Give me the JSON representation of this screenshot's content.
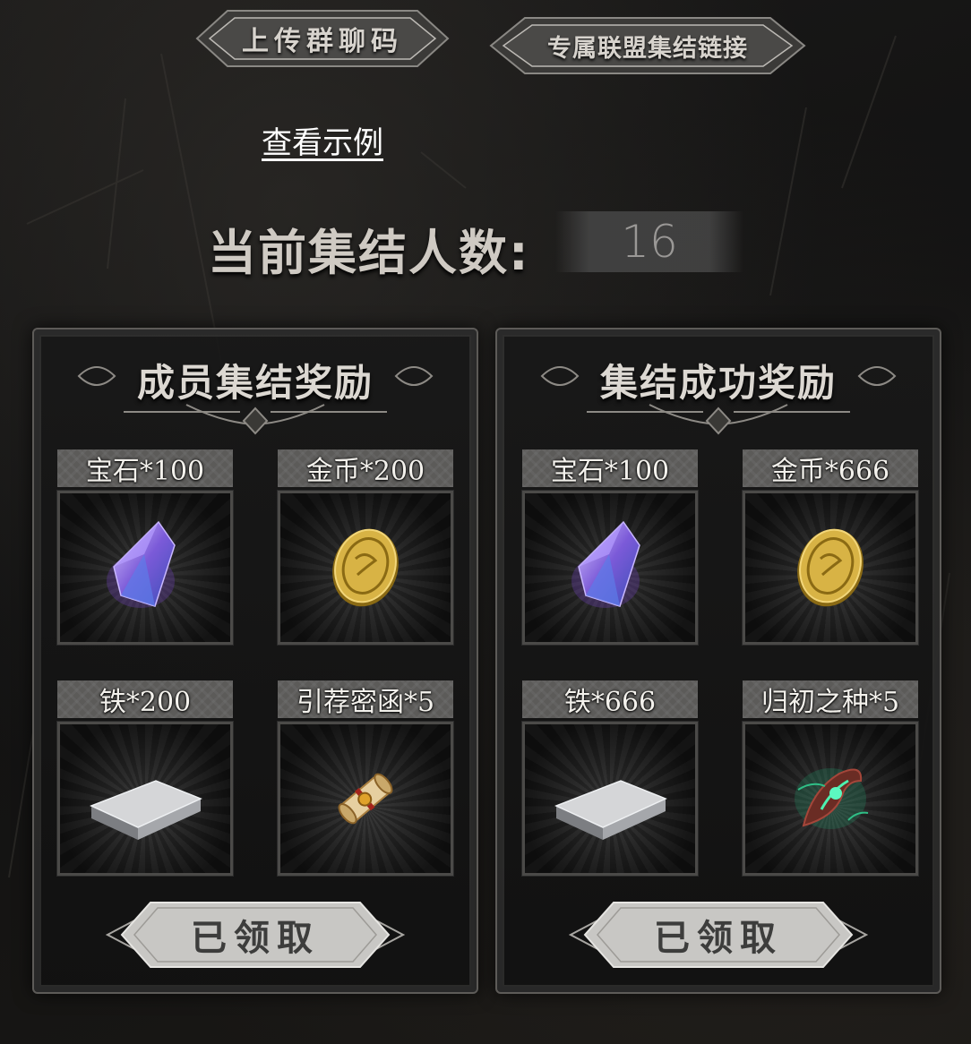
{
  "header": {
    "upload_group_code": "上传群聊码",
    "alliance_link": "专属联盟集结链接",
    "view_example": "查看示例"
  },
  "rally": {
    "count_label": "当前集结人数:",
    "count_value": "16"
  },
  "panels": [
    {
      "title": "成员集结奖励",
      "rewards": [
        {
          "label": "宝石*100",
          "icon": "gem-icon"
        },
        {
          "label": "金币*200",
          "icon": "gold-coin-icon"
        },
        {
          "label": "铁*200",
          "icon": "iron-ingot-icon"
        },
        {
          "label": "引荐密函*5",
          "icon": "scroll-icon"
        }
      ],
      "claim_label": "已领取"
    },
    {
      "title": "集结成功奖励",
      "rewards": [
        {
          "label": "宝石*100",
          "icon": "gem-icon"
        },
        {
          "label": "金币*666",
          "icon": "gold-coin-icon"
        },
        {
          "label": "铁*666",
          "icon": "iron-ingot-icon"
        },
        {
          "label": "归初之种*5",
          "icon": "seed-icon"
        }
      ],
      "claim_label": "已领取"
    }
  ],
  "colors": {
    "background": "#161514",
    "panel_border": "#5d5b58",
    "label_bg": "#5c5b59",
    "claim_button": "#c9c9c7"
  }
}
